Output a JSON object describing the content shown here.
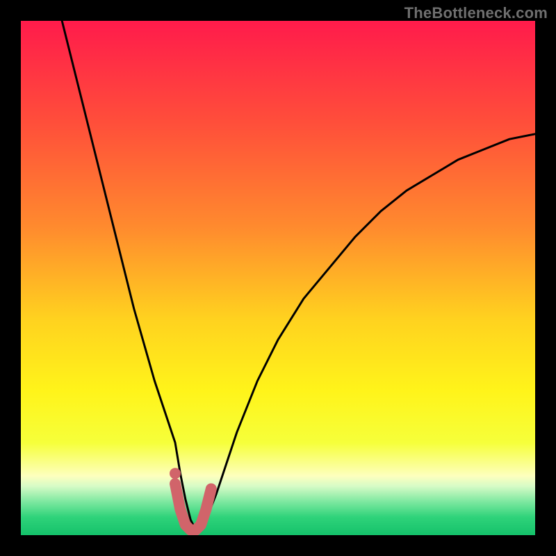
{
  "watermark": "TheBottleneck.com",
  "chart_data": {
    "type": "line",
    "title": "",
    "xlabel": "",
    "ylabel": "",
    "xlim": [
      0,
      100
    ],
    "ylim": [
      0,
      100
    ],
    "series": [
      {
        "name": "bottleneck-curve",
        "x": [
          8,
          10,
          12,
          14,
          16,
          18,
          20,
          22,
          24,
          26,
          28,
          30,
          31,
          32,
          33,
          34,
          35,
          36,
          38,
          40,
          42,
          46,
          50,
          55,
          60,
          65,
          70,
          75,
          80,
          85,
          90,
          95,
          100
        ],
        "y": [
          100,
          92,
          84,
          76,
          68,
          60,
          52,
          44,
          37,
          30,
          24,
          18,
          12,
          7,
          3,
          1,
          1,
          3,
          8,
          14,
          20,
          30,
          38,
          46,
          52,
          58,
          63,
          67,
          70,
          73,
          75,
          77,
          78
        ]
      },
      {
        "name": "highlight-segment",
        "x": [
          30,
          31,
          32,
          33,
          34,
          35,
          36,
          37
        ],
        "y": [
          10,
          5,
          2,
          1,
          1,
          2,
          5,
          9
        ]
      }
    ],
    "highlight_dot": {
      "x": 30,
      "y": 12
    },
    "gradient_stops": [
      {
        "offset": 0.0,
        "color": "#ff1b4b"
      },
      {
        "offset": 0.2,
        "color": "#ff4f3a"
      },
      {
        "offset": 0.4,
        "color": "#ff8a2e"
      },
      {
        "offset": 0.58,
        "color": "#ffd21f"
      },
      {
        "offset": 0.72,
        "color": "#fff41a"
      },
      {
        "offset": 0.82,
        "color": "#f6ff3a"
      },
      {
        "offset": 0.885,
        "color": "#fdffbe"
      },
      {
        "offset": 0.905,
        "color": "#d6fbc6"
      },
      {
        "offset": 0.935,
        "color": "#7de8a0"
      },
      {
        "offset": 0.965,
        "color": "#2fd37a"
      },
      {
        "offset": 1.0,
        "color": "#14c16a"
      }
    ],
    "colors": {
      "curve": "#000000",
      "highlight": "#d1646a",
      "dot": "#d1646a"
    }
  }
}
